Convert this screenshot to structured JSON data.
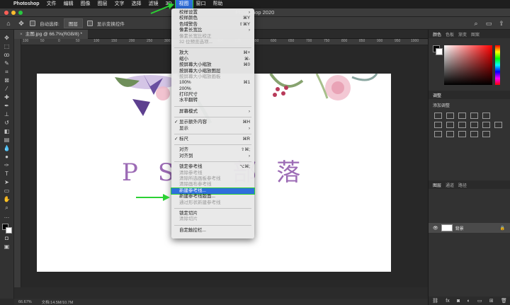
{
  "menubar": {
    "apple": "",
    "items": [
      "Photoshop",
      "文件",
      "编辑",
      "图像",
      "图层",
      "文字",
      "选择",
      "滤镜",
      "3D",
      "视图",
      "窗口",
      "帮助"
    ],
    "active": "视图"
  },
  "titlebar": {
    "title": "Photoshop 2020"
  },
  "optbar": {
    "auto_select_label": "自动选择:",
    "auto_select_value": "图层",
    "show_transform_label": "显示变换控件"
  },
  "document": {
    "tab_title": "主图.jpg @ 66.7%(RGB/8) *",
    "ruler_marks": [
      "100",
      "50",
      "0",
      "50",
      "100",
      "150",
      "200",
      "250",
      "300",
      "350",
      "400",
      "450",
      "500",
      "550",
      "600",
      "650",
      "700",
      "750",
      "800",
      "850",
      "900",
      "950",
      "1000"
    ],
    "canvas_text": [
      "P",
      "S",
      "部",
      "落"
    ]
  },
  "status": {
    "zoom": "66.67%",
    "doc_info": "文档:14.5M/10.7M"
  },
  "panels": {
    "color_tabs": [
      "颜色",
      "色板",
      "渐变",
      "图案"
    ],
    "adjust_tab": "调整",
    "adjust_title": "添加调整",
    "layer_tabs": [
      "图层",
      "通道",
      "路径"
    ],
    "layer_name": "背景"
  },
  "view_menu": {
    "items": [
      {
        "label": "校样设置",
        "shortcut": "",
        "disabled": false,
        "sub": true
      },
      {
        "label": "校样颜色",
        "shortcut": "⌘Y",
        "disabled": false
      },
      {
        "label": "色域警告",
        "shortcut": "⇧⌘Y",
        "disabled": false
      },
      {
        "label": "像素长宽比",
        "shortcut": "",
        "disabled": false,
        "sub": true
      },
      {
        "label": "像素长宽比校正",
        "shortcut": "",
        "disabled": true
      },
      {
        "label": "32 位预览选项...",
        "shortcut": "",
        "disabled": true
      },
      {
        "sep": true
      },
      {
        "label": "放大",
        "shortcut": "⌘+",
        "disabled": false
      },
      {
        "label": "缩小",
        "shortcut": "⌘-",
        "disabled": false
      },
      {
        "label": "按屏幕大小缩放",
        "shortcut": "⌘0",
        "disabled": false
      },
      {
        "label": "按屏幕大小缩放图层",
        "shortcut": "",
        "disabled": false
      },
      {
        "label": "按屏幕大小缩放画板",
        "shortcut": "",
        "disabled": true
      },
      {
        "label": "100%",
        "shortcut": "⌘1",
        "disabled": false
      },
      {
        "label": "200%",
        "shortcut": "",
        "disabled": false
      },
      {
        "label": "打印尺寸",
        "shortcut": "",
        "disabled": false
      },
      {
        "label": "水平翻转",
        "shortcut": "",
        "disabled": false
      },
      {
        "sep": true
      },
      {
        "label": "屏幕模式",
        "shortcut": "",
        "disabled": false,
        "sub": true
      },
      {
        "sep": true
      },
      {
        "label": "显示额外内容",
        "shortcut": "⌘H",
        "disabled": false,
        "checked": true
      },
      {
        "label": "显示",
        "shortcut": "",
        "disabled": false,
        "sub": true
      },
      {
        "sep": true
      },
      {
        "label": "标尺",
        "shortcut": "⌘R",
        "disabled": false,
        "checked": true
      },
      {
        "sep": true
      },
      {
        "label": "对齐",
        "shortcut": "⇧⌘;",
        "disabled": false
      },
      {
        "label": "对齐到",
        "shortcut": "",
        "disabled": false,
        "sub": true
      },
      {
        "sep": true
      },
      {
        "label": "锁定参考线",
        "shortcut": "⌥⌘;",
        "disabled": false
      },
      {
        "label": "清除参考线",
        "shortcut": "",
        "disabled": true
      },
      {
        "label": "清除所选画板参考线",
        "shortcut": "",
        "disabled": true
      },
      {
        "label": "清除画布参考线",
        "shortcut": "",
        "disabled": true
      },
      {
        "label": "新建参考线...",
        "shortcut": "",
        "disabled": false,
        "highlight": true
      },
      {
        "label": "新建参考线版面...",
        "shortcut": "",
        "disabled": false
      },
      {
        "label": "通过形状新建参考线",
        "shortcut": "",
        "disabled": true
      },
      {
        "sep": true
      },
      {
        "label": "锁定切片",
        "shortcut": "",
        "disabled": false
      },
      {
        "label": "清除切片",
        "shortcut": "",
        "disabled": true
      },
      {
        "sep": true
      },
      {
        "label": "自定触控栏...",
        "shortcut": "",
        "disabled": false
      }
    ]
  },
  "colors": {
    "accent_green": "#2bd134",
    "highlight_blue": "#2f6fdc"
  }
}
